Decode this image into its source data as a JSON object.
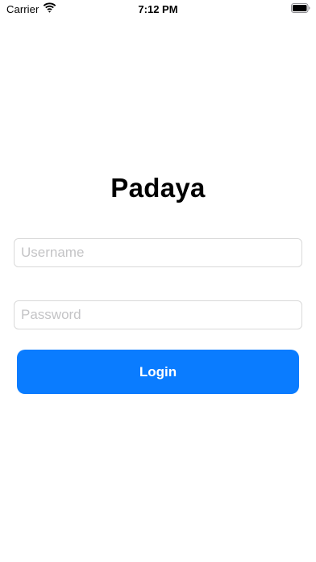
{
  "status_bar": {
    "carrier": "Carrier",
    "time": "7:12 PM",
    "wifi_icon": "wifi-icon",
    "battery_icon": "battery-icon"
  },
  "app": {
    "title": "Padaya"
  },
  "form": {
    "username": {
      "value": "",
      "placeholder": "Username"
    },
    "password": {
      "value": "",
      "placeholder": "Password"
    },
    "login_label": "Login"
  },
  "colors": {
    "accent": "#0a7cff",
    "field_border": "#d9d9d9",
    "placeholder": "#c4c4c6"
  }
}
